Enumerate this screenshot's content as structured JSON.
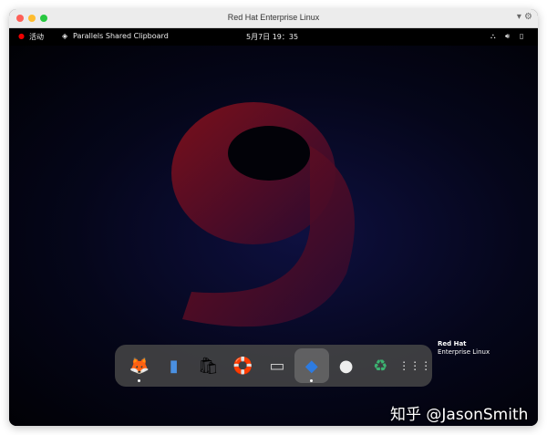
{
  "window": {
    "title": "Red Hat Enterprise Linux"
  },
  "topbar": {
    "activities": "活动",
    "app_menu": "Parallels Shared Clipboard",
    "clock": "5月7日 19：35"
  },
  "dock": {
    "apps": [
      "Firefox",
      "Files",
      "Software",
      "Help",
      "Terminal",
      "Parallels Tools",
      "Disc",
      "Trash",
      "Show Applications"
    ]
  },
  "branding": {
    "line1": "Red Hat",
    "line2": "Enterprise Linux"
  },
  "watermark": "知乎 @JasonSmith",
  "colors": {
    "accent": "#ee0000"
  }
}
